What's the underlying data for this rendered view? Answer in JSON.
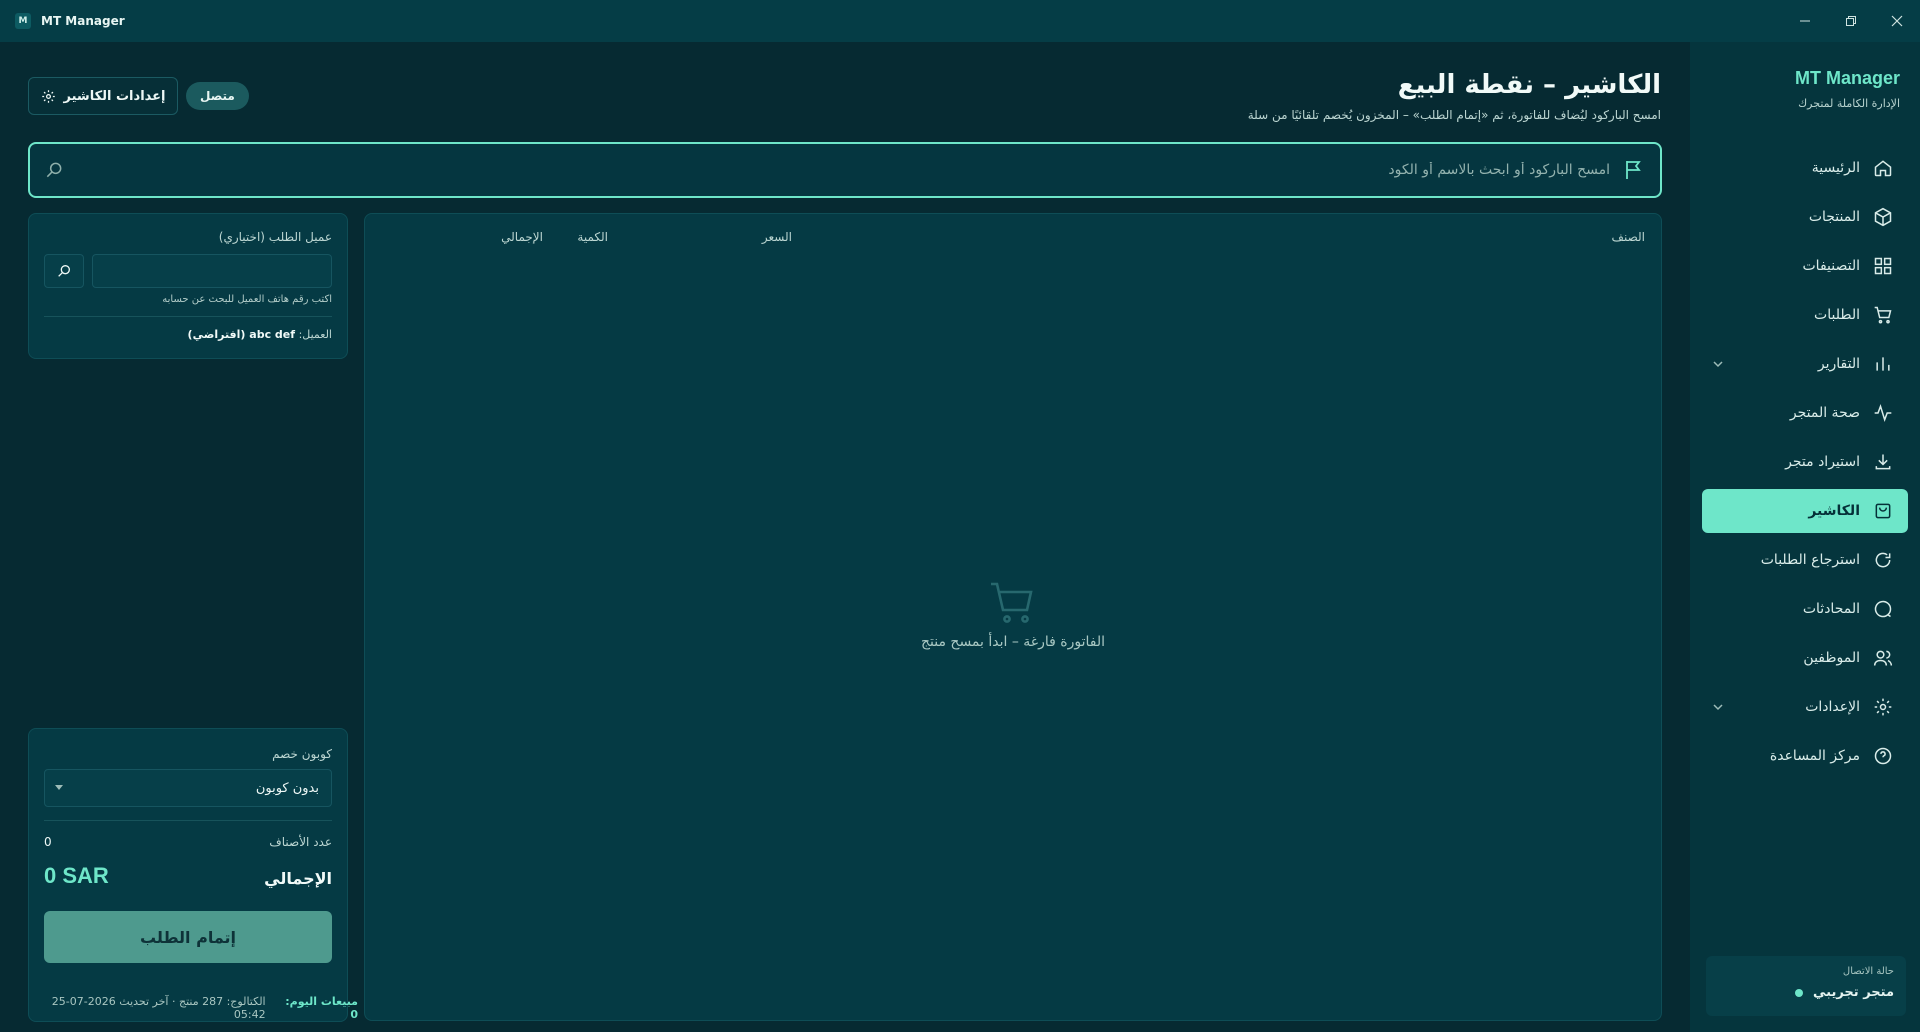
{
  "window": {
    "title": "MT Manager",
    "logo_letter": "M"
  },
  "sidebar": {
    "brand": "MT Manager",
    "tagline": "الإدارة الكاملة لمتجرك",
    "items": [
      {
        "label": "الرئيسية",
        "icon": "home-icon"
      },
      {
        "label": "المنتجات",
        "icon": "box-icon"
      },
      {
        "label": "التصنيفات",
        "icon": "grid-icon"
      },
      {
        "label": "الطلبات",
        "icon": "cart-icon"
      },
      {
        "label": "التقارير",
        "icon": "bar-chart-icon",
        "expandable": true
      },
      {
        "label": "صحة المتجر",
        "icon": "pulse-icon"
      },
      {
        "label": "استيراد متجر",
        "icon": "download-icon"
      },
      {
        "label": "الكاشير",
        "icon": "shopping-bag-icon",
        "active": true
      },
      {
        "label": "استرجاع الطلبات",
        "icon": "refresh-icon"
      },
      {
        "label": "المحادثات",
        "icon": "chat-icon"
      },
      {
        "label": "الموظفين",
        "icon": "users-icon"
      },
      {
        "label": "الإعدادات",
        "icon": "gear-icon",
        "expandable": true
      },
      {
        "label": "مركز المساعدة",
        "icon": "help-icon"
      }
    ],
    "connection": {
      "label": "حالة الاتصال",
      "value": "متجر تجريبي"
    }
  },
  "header": {
    "title": "الكاشير – نقطة البيع",
    "subtitle": "امسح الباركود ليُضاف للفاتورة، ثم «إتمام الطلب» – المخزون يُخصم تلقائيًا من سلة",
    "settings_label": "إعدادات الكاشير",
    "status": "متصل"
  },
  "search": {
    "placeholder": "امسح الباركود أو ابحث بالاسم أو الكود",
    "value": ""
  },
  "invoice": {
    "columns": {
      "item": "الصنف",
      "price": "السعر",
      "qty": "الكمية",
      "total": "الإجمالي"
    },
    "empty_text": "الفاتورة فارغة – ابدأ بمسح منتج"
  },
  "customer": {
    "label": "عميل الطلب (اختياري)",
    "value": "",
    "hint": "اكتب رقم هاتف العميل للبحث عن حسابه",
    "current_prefix": "العميل:",
    "current_name": "abc def (افتراضي)"
  },
  "totals": {
    "coupon_label": "كوبون خصم",
    "coupon_selected": "بدون كوبون",
    "count_label": "عدد الأصناف",
    "count_value": "0",
    "total_label": "الإجمالي",
    "total_value": "0 SAR",
    "checkout_label": "إتمام الطلب"
  },
  "footer": {
    "sales": "مبيعات اليوم: 0",
    "catalog": "الكتالوج: 287 منتج · آخر تحديث 2026-07-25 05:42"
  },
  "colors": {
    "accent": "#6ee6c9",
    "background": "#062a32",
    "sidebar": "#05353d",
    "panel": "#053a44"
  }
}
